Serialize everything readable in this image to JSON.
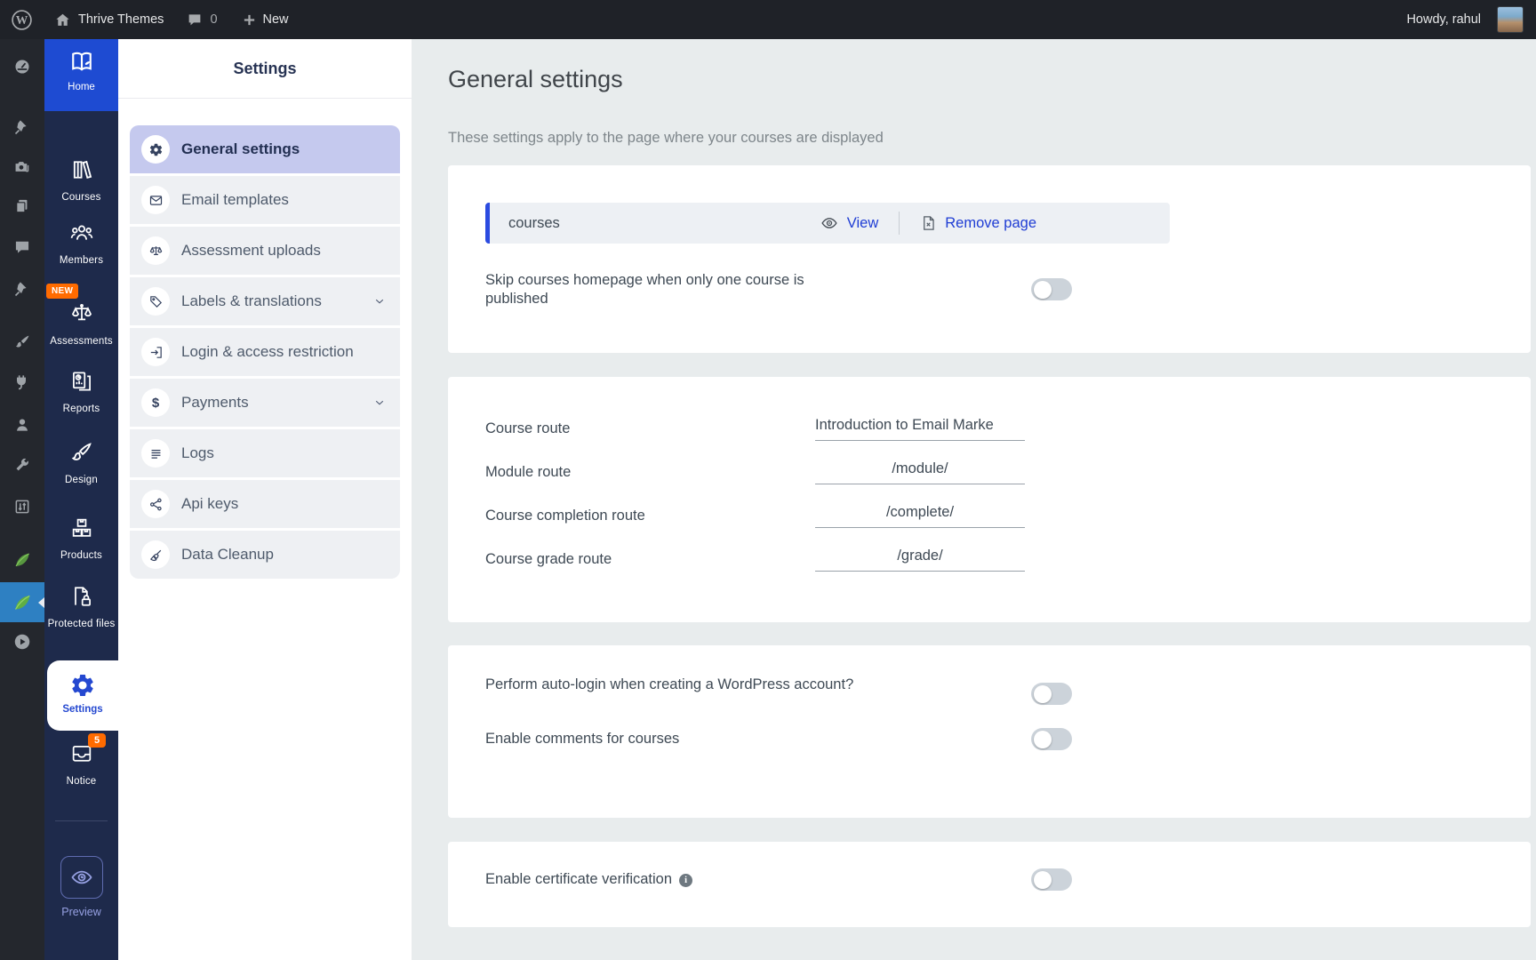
{
  "admin_bar": {
    "site_name": "Thrive Themes",
    "comments_count": "0",
    "new_label": "New",
    "howdy_text": "Howdy, rahul"
  },
  "wp_rail_icons": [
    "dashboard",
    "pin",
    "media",
    "pages",
    "comments",
    "pin",
    "appearance-brush",
    "plugins-plug",
    "users",
    "tools-wrench",
    "settings-sliders",
    "thrive-leaf",
    "thrive-apprentice-active-leaf",
    "video-play"
  ],
  "app_rail": {
    "items": [
      {
        "label": "Home",
        "icon": "open-book",
        "active": true
      },
      {
        "label": "Courses",
        "icon": "bookshelf"
      },
      {
        "label": "Members",
        "icon": "people-group"
      },
      {
        "label": "Assessments",
        "icon": "balance-scales",
        "badge": "NEW"
      },
      {
        "label": "Reports",
        "icon": "report-documents"
      },
      {
        "label": "Design",
        "icon": "paint-brush"
      },
      {
        "label": "Products",
        "icon": "boxes"
      },
      {
        "label": "Protected files",
        "icon": "file-lock"
      },
      {
        "label": "Settings",
        "icon": "gear",
        "active": true
      },
      {
        "label": "Notice",
        "icon": "inbox-tray",
        "badge": "5"
      },
      {
        "label": "Preview",
        "icon": "eye"
      }
    ]
  },
  "settings_menu": {
    "title": "Settings",
    "items": [
      {
        "label": "General settings",
        "icon": "gear",
        "active": true
      },
      {
        "label": "Email templates",
        "icon": "envelope"
      },
      {
        "label": "Assessment uploads",
        "icon": "balance-scales"
      },
      {
        "label": "Labels & translations",
        "icon": "tag",
        "expandable": true
      },
      {
        "label": "Login & access restriction",
        "icon": "login-arrow"
      },
      {
        "label": "Payments",
        "icon": "dollar",
        "expandable": true
      },
      {
        "label": "Logs",
        "icon": "list-lines"
      },
      {
        "label": "Api keys",
        "icon": "network-nodes"
      },
      {
        "label": "Data Cleanup",
        "icon": "broom"
      }
    ]
  },
  "content": {
    "title": "General settings",
    "subtitle": "These settings apply to the page where your courses are displayed",
    "course_page": {
      "name": "courses",
      "view_label": "View",
      "remove_label": "Remove page"
    },
    "routes": [
      {
        "label": "Course route",
        "value": "Introduction to Email Marke"
      },
      {
        "label": "Module route",
        "value": "/module/"
      },
      {
        "label": "Course completion route",
        "value": "/complete/"
      },
      {
        "label": "Course grade route",
        "value": "/grade/"
      }
    ],
    "toggles": {
      "skip_homepage": {
        "label": "Skip courses homepage when only one course is published",
        "enabled": false
      },
      "auto_login": {
        "label": "Perform auto-login when creating a WordPress account?",
        "enabled": false
      },
      "comments": {
        "label": "Enable comments for courses",
        "enabled": false
      },
      "certificate": {
        "label": "Enable certificate verification",
        "enabled": false,
        "has_info": true
      }
    }
  },
  "colors": {
    "accent_blue": "#1e4bd2",
    "link_blue": "#1f3dd4",
    "rail_navy": "#1e2a4b",
    "active_item_lavender": "#c5c9ee",
    "badge_orange": "#ff6b00",
    "toggle_off": "#ccd3da",
    "main_background": "#e8eced"
  }
}
